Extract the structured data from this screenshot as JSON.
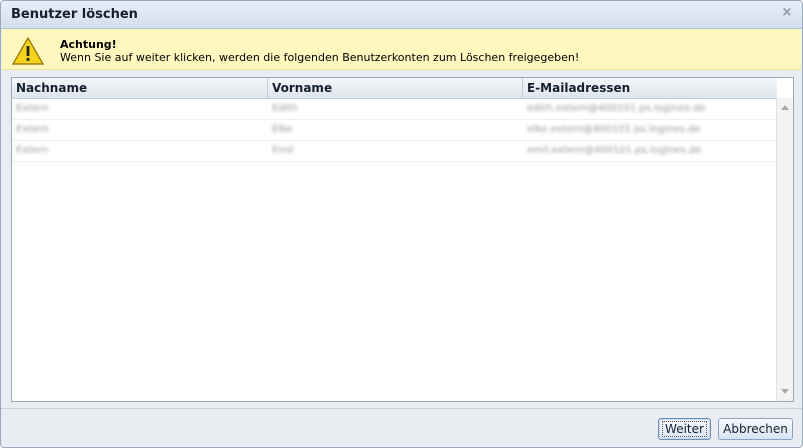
{
  "dialog": {
    "title": "Benutzer löschen",
    "close_icon": "close-icon"
  },
  "warning": {
    "icon": "warning-icon",
    "title": "Achtung!",
    "text": "Wenn Sie auf weiter klicken, werden die folgenden Benutzerkonten zum Löschen freigegeben!"
  },
  "grid": {
    "columns": [
      "Nachname",
      "Vorname",
      "E-Mailadressen"
    ],
    "rows": [
      [
        "Extern",
        "Edith",
        "edith.extern@400101.ps.logines.de"
      ],
      [
        "Extern",
        "Elke",
        "elke.extern@400101.ps.logines.de"
      ],
      [
        "Extern",
        "Emil",
        "emil.extern@400101.ps.logines.de"
      ]
    ]
  },
  "footer": {
    "weiter_label": "Weiter",
    "abbrechen_label": "Abbrechen"
  },
  "colors": {
    "warning_bg": "#fef8bf",
    "titlebar": "#dbe4f0",
    "accent_border": "#99a8bc"
  }
}
